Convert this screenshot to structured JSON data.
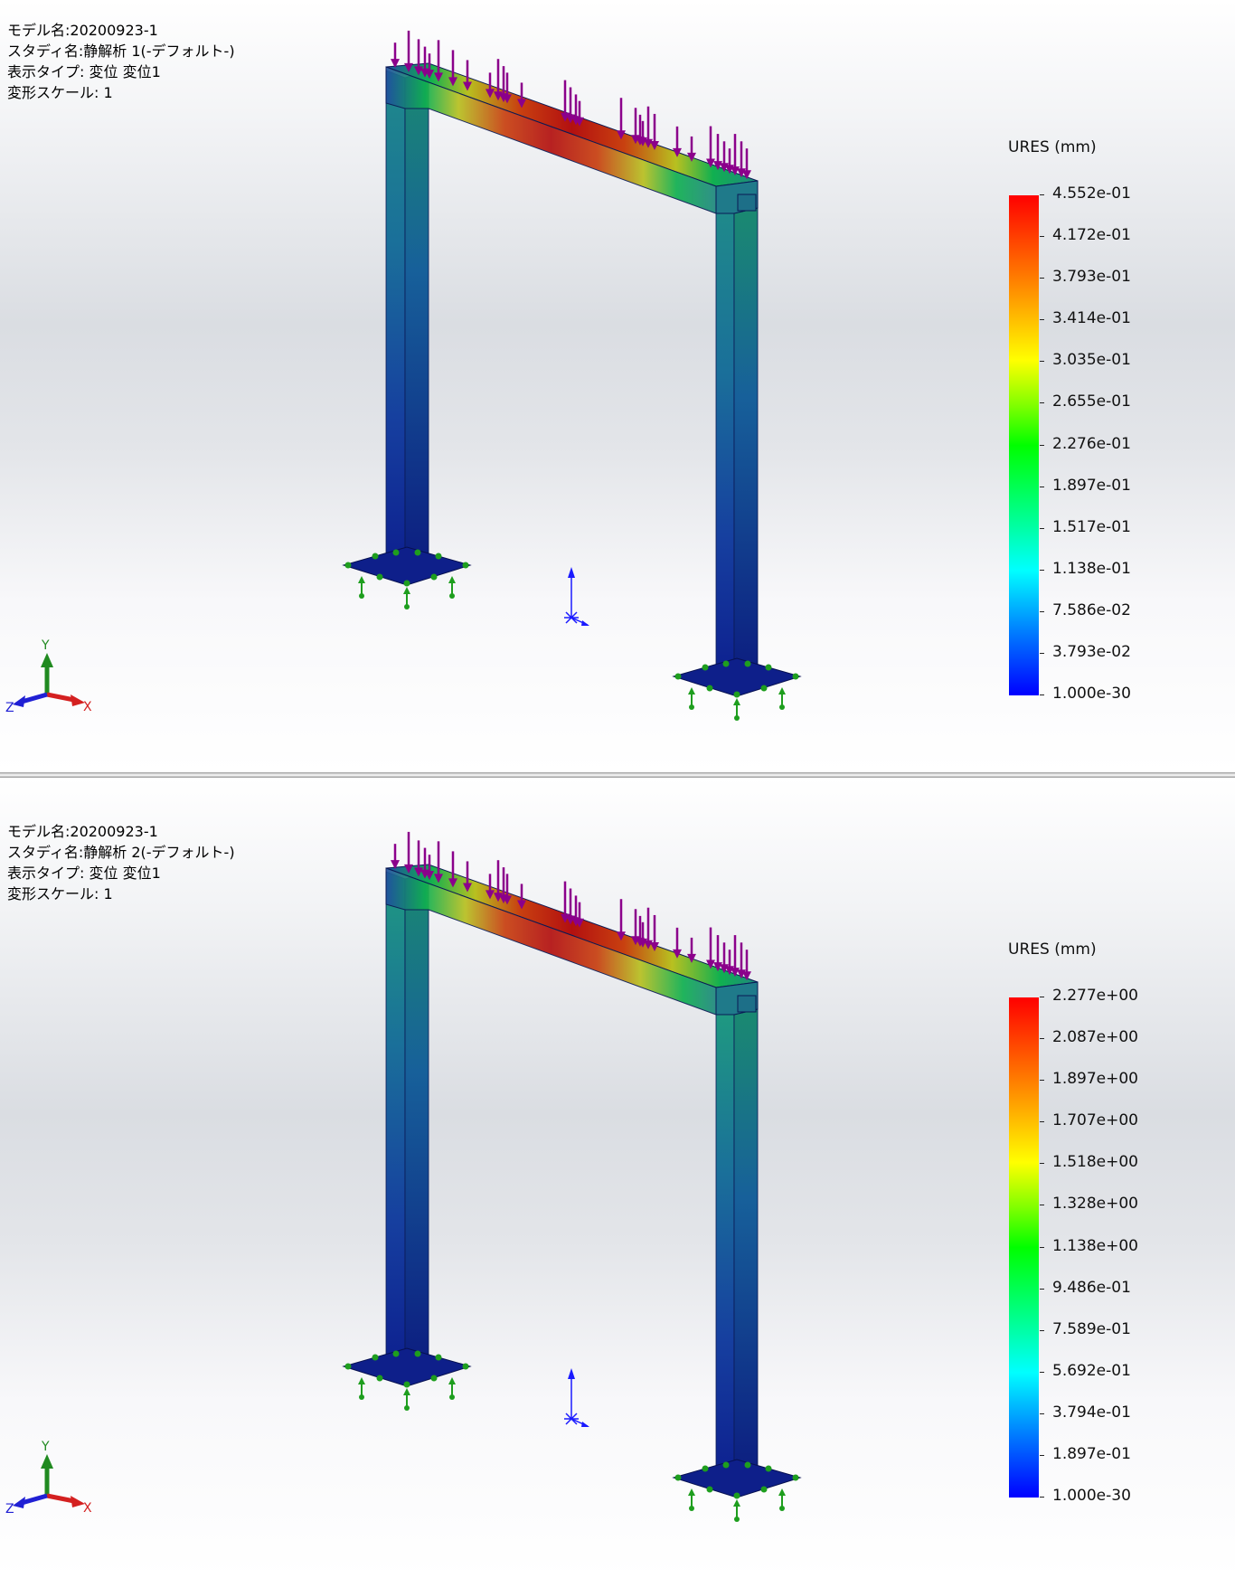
{
  "panels": [
    {
      "info": {
        "model": "モデル名:20200923-1",
        "study": "スタディ名:静解析 1(-デフォルト-)",
        "plot_type": "表示タイプ: 変位 変位1",
        "scale": "変形スケール: 1"
      },
      "legend": {
        "title": "URES (mm)",
        "values": [
          "4.552e-01",
          "4.172e-01",
          "3.793e-01",
          "3.414e-01",
          "3.035e-01",
          "2.655e-01",
          "2.276e-01",
          "1.897e-01",
          "1.517e-01",
          "1.138e-01",
          "7.586e-02",
          "3.793e-02",
          "1.000e-30"
        ]
      },
      "triad": {
        "x": "X",
        "y": "Y",
        "z": "Z"
      }
    },
    {
      "info": {
        "model": "モデル名:20200923-1",
        "study": "スタディ名:静解析 2(-デフォルト-)",
        "plot_type": "表示タイプ: 変位 変位1",
        "scale": "変形スケール: 1"
      },
      "legend": {
        "title": "URES (mm)",
        "values": [
          "2.277e+00",
          "2.087e+00",
          "1.897e+00",
          "1.707e+00",
          "1.518e+00",
          "1.328e+00",
          "1.138e+00",
          "9.486e-01",
          "7.589e-01",
          "5.692e-01",
          "3.794e-01",
          "1.897e-01",
          "1.000e-30"
        ]
      },
      "triad": {
        "x": "X",
        "y": "Y",
        "z": "Z"
      }
    }
  ],
  "colors": {
    "load_arrow": "#8b008b",
    "fixture": "#1e9e1e",
    "ref_axis": "#1a1aff",
    "triad_x": "#d42020",
    "triad_y": "#208a20",
    "triad_z": "#2020d4"
  }
}
